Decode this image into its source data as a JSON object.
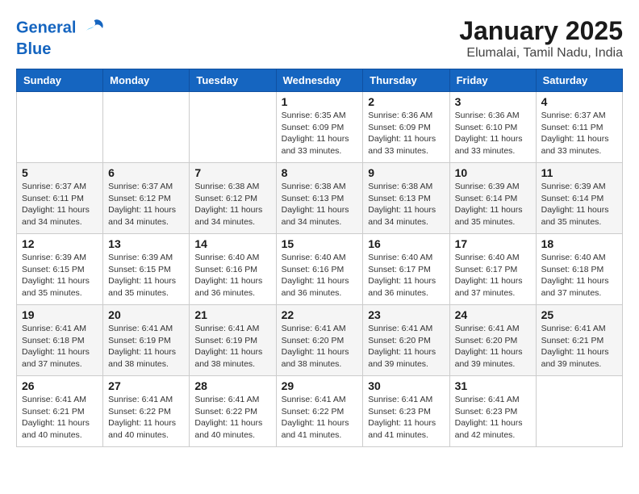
{
  "header": {
    "logo_line1": "General",
    "logo_line2": "Blue",
    "month_title": "January 2025",
    "location": "Elumalai, Tamil Nadu, India"
  },
  "weekdays": [
    "Sunday",
    "Monday",
    "Tuesday",
    "Wednesday",
    "Thursday",
    "Friday",
    "Saturday"
  ],
  "weeks": [
    [
      {
        "day": "",
        "info": ""
      },
      {
        "day": "",
        "info": ""
      },
      {
        "day": "",
        "info": ""
      },
      {
        "day": "1",
        "info": "Sunrise: 6:35 AM\nSunset: 6:09 PM\nDaylight: 11 hours\nand 33 minutes."
      },
      {
        "day": "2",
        "info": "Sunrise: 6:36 AM\nSunset: 6:09 PM\nDaylight: 11 hours\nand 33 minutes."
      },
      {
        "day": "3",
        "info": "Sunrise: 6:36 AM\nSunset: 6:10 PM\nDaylight: 11 hours\nand 33 minutes."
      },
      {
        "day": "4",
        "info": "Sunrise: 6:37 AM\nSunset: 6:11 PM\nDaylight: 11 hours\nand 33 minutes."
      }
    ],
    [
      {
        "day": "5",
        "info": "Sunrise: 6:37 AM\nSunset: 6:11 PM\nDaylight: 11 hours\nand 34 minutes."
      },
      {
        "day": "6",
        "info": "Sunrise: 6:37 AM\nSunset: 6:12 PM\nDaylight: 11 hours\nand 34 minutes."
      },
      {
        "day": "7",
        "info": "Sunrise: 6:38 AM\nSunset: 6:12 PM\nDaylight: 11 hours\nand 34 minutes."
      },
      {
        "day": "8",
        "info": "Sunrise: 6:38 AM\nSunset: 6:13 PM\nDaylight: 11 hours\nand 34 minutes."
      },
      {
        "day": "9",
        "info": "Sunrise: 6:38 AM\nSunset: 6:13 PM\nDaylight: 11 hours\nand 34 minutes."
      },
      {
        "day": "10",
        "info": "Sunrise: 6:39 AM\nSunset: 6:14 PM\nDaylight: 11 hours\nand 35 minutes."
      },
      {
        "day": "11",
        "info": "Sunrise: 6:39 AM\nSunset: 6:14 PM\nDaylight: 11 hours\nand 35 minutes."
      }
    ],
    [
      {
        "day": "12",
        "info": "Sunrise: 6:39 AM\nSunset: 6:15 PM\nDaylight: 11 hours\nand 35 minutes."
      },
      {
        "day": "13",
        "info": "Sunrise: 6:39 AM\nSunset: 6:15 PM\nDaylight: 11 hours\nand 35 minutes."
      },
      {
        "day": "14",
        "info": "Sunrise: 6:40 AM\nSunset: 6:16 PM\nDaylight: 11 hours\nand 36 minutes."
      },
      {
        "day": "15",
        "info": "Sunrise: 6:40 AM\nSunset: 6:16 PM\nDaylight: 11 hours\nand 36 minutes."
      },
      {
        "day": "16",
        "info": "Sunrise: 6:40 AM\nSunset: 6:17 PM\nDaylight: 11 hours\nand 36 minutes."
      },
      {
        "day": "17",
        "info": "Sunrise: 6:40 AM\nSunset: 6:17 PM\nDaylight: 11 hours\nand 37 minutes."
      },
      {
        "day": "18",
        "info": "Sunrise: 6:40 AM\nSunset: 6:18 PM\nDaylight: 11 hours\nand 37 minutes."
      }
    ],
    [
      {
        "day": "19",
        "info": "Sunrise: 6:41 AM\nSunset: 6:18 PM\nDaylight: 11 hours\nand 37 minutes."
      },
      {
        "day": "20",
        "info": "Sunrise: 6:41 AM\nSunset: 6:19 PM\nDaylight: 11 hours\nand 38 minutes."
      },
      {
        "day": "21",
        "info": "Sunrise: 6:41 AM\nSunset: 6:19 PM\nDaylight: 11 hours\nand 38 minutes."
      },
      {
        "day": "22",
        "info": "Sunrise: 6:41 AM\nSunset: 6:20 PM\nDaylight: 11 hours\nand 38 minutes."
      },
      {
        "day": "23",
        "info": "Sunrise: 6:41 AM\nSunset: 6:20 PM\nDaylight: 11 hours\nand 39 minutes."
      },
      {
        "day": "24",
        "info": "Sunrise: 6:41 AM\nSunset: 6:20 PM\nDaylight: 11 hours\nand 39 minutes."
      },
      {
        "day": "25",
        "info": "Sunrise: 6:41 AM\nSunset: 6:21 PM\nDaylight: 11 hours\nand 39 minutes."
      }
    ],
    [
      {
        "day": "26",
        "info": "Sunrise: 6:41 AM\nSunset: 6:21 PM\nDaylight: 11 hours\nand 40 minutes."
      },
      {
        "day": "27",
        "info": "Sunrise: 6:41 AM\nSunset: 6:22 PM\nDaylight: 11 hours\nand 40 minutes."
      },
      {
        "day": "28",
        "info": "Sunrise: 6:41 AM\nSunset: 6:22 PM\nDaylight: 11 hours\nand 40 minutes."
      },
      {
        "day": "29",
        "info": "Sunrise: 6:41 AM\nSunset: 6:22 PM\nDaylight: 11 hours\nand 41 minutes."
      },
      {
        "day": "30",
        "info": "Sunrise: 6:41 AM\nSunset: 6:23 PM\nDaylight: 11 hours\nand 41 minutes."
      },
      {
        "day": "31",
        "info": "Sunrise: 6:41 AM\nSunset: 6:23 PM\nDaylight: 11 hours\nand 42 minutes."
      },
      {
        "day": "",
        "info": ""
      }
    ]
  ]
}
